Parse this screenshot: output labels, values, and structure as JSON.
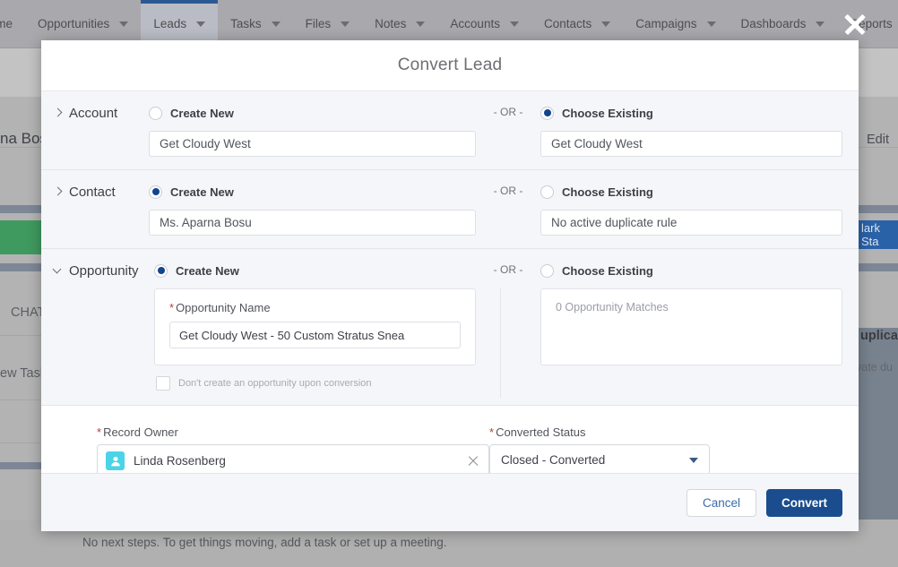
{
  "nav": {
    "items": [
      {
        "label": "Home",
        "has_caret": false,
        "active": false
      },
      {
        "label": "Opportunities",
        "has_caret": true,
        "active": false
      },
      {
        "label": "Leads",
        "has_caret": true,
        "active": true
      },
      {
        "label": "Tasks",
        "has_caret": true,
        "active": false
      },
      {
        "label": "Files",
        "has_caret": true,
        "active": false
      },
      {
        "label": "Notes",
        "has_caret": true,
        "active": false
      },
      {
        "label": "Accounts",
        "has_caret": true,
        "active": false
      },
      {
        "label": "Contacts",
        "has_caret": true,
        "active": false
      },
      {
        "label": "Campaigns",
        "has_caret": true,
        "active": false
      },
      {
        "label": "Dashboards",
        "has_caret": true,
        "active": false
      },
      {
        "label": "Reports",
        "has_caret": true,
        "active": false
      }
    ]
  },
  "background": {
    "record_name": "na Bos",
    "edit_label": "Edit",
    "chatter_label": "CHAT",
    "new_task_label": "ew Task",
    "mark_status_label": "lark Sta",
    "duplicates_heading": "uplica",
    "duplicates_sub": "vate du",
    "next_steps": "No next steps. To get things moving, add a task or set up a meeting."
  },
  "modal": {
    "title": "Convert Lead",
    "or_label": "- OR -",
    "sections": [
      {
        "name": "Account",
        "expanded": false,
        "left": {
          "radio_label": "Create New",
          "selected": false,
          "value": "Get Cloudy West"
        },
        "right": {
          "radio_label": "Choose Existing",
          "selected": true,
          "value": "Get Cloudy West"
        }
      },
      {
        "name": "Contact",
        "expanded": false,
        "left": {
          "radio_label": "Create New",
          "selected": true,
          "value": "Ms. Aparna Bosu"
        },
        "right": {
          "radio_label": "Choose Existing",
          "selected": false,
          "value": "No active duplicate rule"
        }
      }
    ],
    "opportunity": {
      "name": "Opportunity",
      "expanded": true,
      "left": {
        "radio_label": "Create New",
        "selected": true,
        "field_label": "Opportunity Name",
        "field_required": true,
        "field_value": "Get Cloudy West - 50 Custom Stratus Snea",
        "checkbox_label": "Don't create an opportunity upon conversion",
        "checkbox_checked": false
      },
      "right": {
        "radio_label": "Choose Existing",
        "selected": false,
        "matches_text": "0 Opportunity Matches"
      }
    },
    "record_owner": {
      "label": "Record Owner",
      "required": true,
      "value": "Linda Rosenberg",
      "clear_icon": "close-icon"
    },
    "converted_status": {
      "label": "Converted Status",
      "required": true,
      "value": "Closed - Converted",
      "options": [
        "Closed - Converted"
      ]
    },
    "footer": {
      "cancel_label": "Cancel",
      "convert_label": "Convert"
    },
    "close_icon": "close-icon"
  },
  "colors": {
    "brand_blue": "#1b4d8e",
    "radio_selected": "#11458e",
    "avatar_teal": "#4bd4e8",
    "required_red": "#c23934",
    "active_tab_underline": "#2a5a93"
  }
}
